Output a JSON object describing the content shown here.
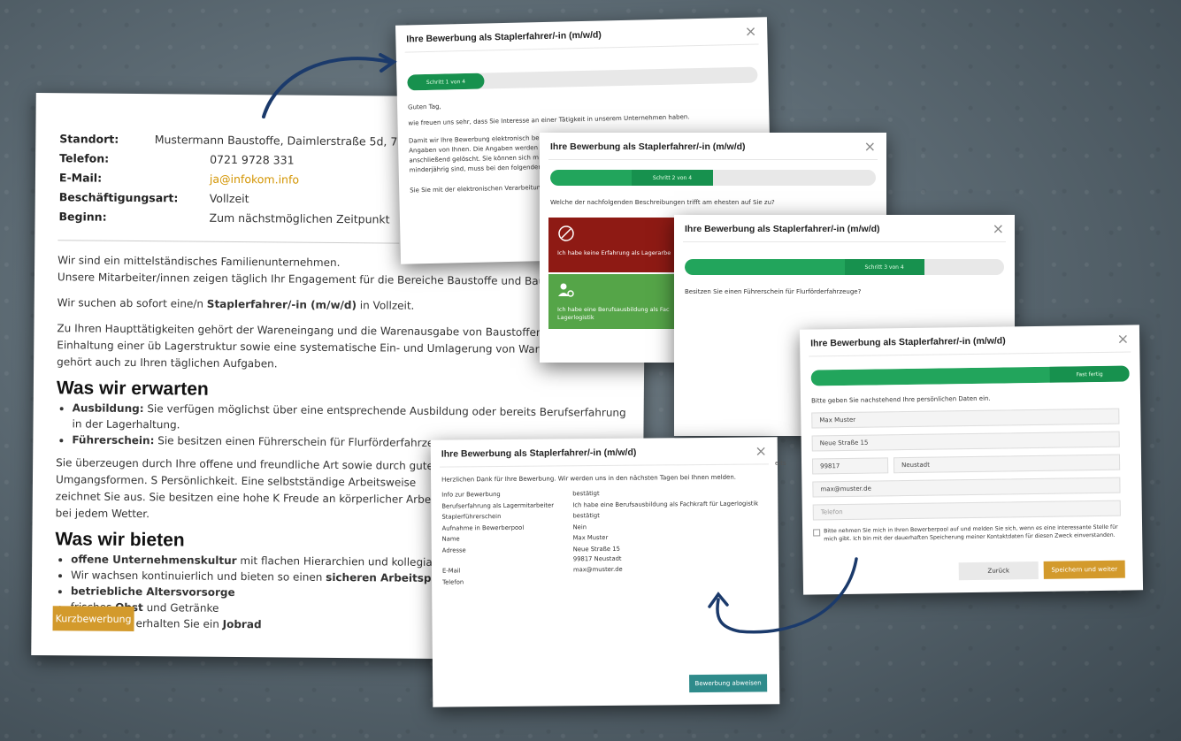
{
  "colors": {
    "accent": "#d39a2c",
    "green": "#22a55c",
    "red": "#8e1a14",
    "teal": "#2f8b8b"
  },
  "job": {
    "info": [
      {
        "k": "Standort:",
        "v": "Mustermann Baustoffe, Daimlerstraße 5d, 76"
      },
      {
        "k": "Telefon:",
        "v": "0721 9728 331"
      },
      {
        "k": "E-Mail:",
        "v": "ja@infokom.info"
      },
      {
        "k": "Beschäftigungsart:",
        "v": "Vollzeit"
      },
      {
        "k": "Beginn:",
        "v": "Zum nächstmöglichen Zeitpunkt"
      }
    ],
    "intro1": "Wir sind ein mittelständisches Familienunternehmen.",
    "intro2": "Unsere Mitarbeiter/innen zeigen täglich Ihr Engagement für die Bereiche Baustoffe und Baumarkt.",
    "search_pre": "Wir suchen ab sofort eine/n ",
    "search_bold": "Staplerfahrer/-in (m/w/d)",
    "search_post": " in Vollzeit.",
    "tasks": "Zu Ihren Haupttätigkeiten gehört der Wareneingang und die Warenausgabe von Baustoffen. Die Einhaltung einer üb Lagerstruktur sowie eine systematische Ein- und Umlagerung von Waren gehört auch zu Ihren täglichen Aufgaben.",
    "h_expect": "Was wir erwarten",
    "expect": [
      {
        "b": "Ausbildung:",
        "t": " Sie verfügen möglichst über eine entsprechende Ausbildung oder bereits Berufserfahrung in der Lagerhaltung."
      },
      {
        "b": "Führerschein:",
        "t": " Sie besitzen einen Führerschein für Flurförderfahrzeuge."
      }
    ],
    "person": "Sie überzeugen durch Ihre offene und freundliche Art sowie durch gute Umgangsformen. S Persönlichkeit. Eine selbstständige Arbeitsweise zeichnet Sie aus. Sie besitzen eine hohe K Freude an körperlicher Arbeit bei jedem Wetter.",
    "h_offer": "Was wir bieten",
    "offer": [
      {
        "b": "offene Unternehmenskultur",
        "t": " mit flachen Hierarchien und kollegialer Arbeitsatmosph",
        "pre": ""
      },
      {
        "pre": "Wir wachsen kontinuierlich und bieten so einen ",
        "b": "sicheren Arbeitsplatz",
        "t": ""
      },
      {
        "pre": "",
        "b": "betriebliche Altersvorsorge",
        "t": ""
      },
      {
        "pre": "frisches ",
        "b": "Obst",
        "t": " und Getränke"
      },
      {
        "pre": "auf Wunsch erhalten Sie ein ",
        "b": "Jobrad",
        "t": ""
      }
    ],
    "cta": "Kurzbewerbung"
  },
  "modal": {
    "title": "Ihre Bewerbung als Staplerfahrer/-in (m/w/d)",
    "close": "×"
  },
  "m1": {
    "step": "Schritt 1 von 4",
    "progress": 0.22,
    "greet": "Guten Tag,",
    "p1": "wie freuen uns sehr, dass Sie Interesse an einer Tätigkeit in unserem Unternehmen haben.",
    "p2a": "Damit wir Ihre Bewerbung elektronisch be",
    "p2b": "Angaben von Ihnen. Die Angaben werden v",
    "p2c": "anschließend gelöscht. Sie können sich m",
    "p2d": "minderjährig sind, muss bei den folgender",
    "p3": "Sie Sie mit der elektronischen Verarbeitun"
  },
  "m2": {
    "step": "Schritt 2 von 4",
    "progress": 0.5,
    "q": "Welche der nachfolgenden Beschreibungen trifft am ehesten auf Sie zu?",
    "c1": "Ich habe keine Erfahrung als Lagerarbe",
    "c2": "Ich habe eine Berufsausbildung als Fac Lagerlogistik"
  },
  "m3": {
    "step": "Schritt 3 von 4",
    "progress": 0.75,
    "q": "Besitzen Sie einen Führerschein für Flurförderfahrzeuge?"
  },
  "m4": {
    "step": "Fast fertig",
    "progress": 1.0,
    "q": "Bitte geben Sie nachstehend Ihre persönlichen Daten ein.",
    "name": "Max Muster",
    "street": "Neue Straße 15",
    "zip": "99817",
    "city": "Neustadt",
    "email": "max@muster.de",
    "phone_ph": "Telefon",
    "consent": "Bitte nehmen Sie mich in Ihren Bewerberpool auf und melden Sie sich, wenn es eine interessante Stelle für mich gibt. Ich bin mit der dauerhaften Speicherung meiner Kontaktdaten für diesen Zweck einverstanden.",
    "back": "Zurück",
    "save": "Speichern und weiter"
  },
  "m5": {
    "thanks": "Herzlichen Dank für Ihre Bewerbung. Wir werden uns in den nächsten Tagen bei Ihnen melden.",
    "rows": [
      {
        "k": "Info zur Bewerbung",
        "v": "bestätigt"
      },
      {
        "k": "Berufserfahrung als Lagermitarbeiter",
        "v": "Ich habe eine Berufsausbildung als Fachkraft für Lagerlogistik"
      },
      {
        "k": "Staplerführerschein",
        "v": "bestätigt"
      },
      {
        "k": "Aufnahme in Bewerberpool",
        "v": "Nein"
      },
      {
        "k": "Name",
        "v": "Max Muster"
      },
      {
        "k": "Adresse",
        "v": "Neue Straße 15"
      },
      {
        "k": "",
        "v": "99817 Neustadt"
      },
      {
        "k": "E-Mail",
        "v": "max@muster.de"
      },
      {
        "k": "Telefon",
        "v": ""
      }
    ],
    "finish": "Bewerbung abweisen"
  },
  "side_fragment": "eits"
}
